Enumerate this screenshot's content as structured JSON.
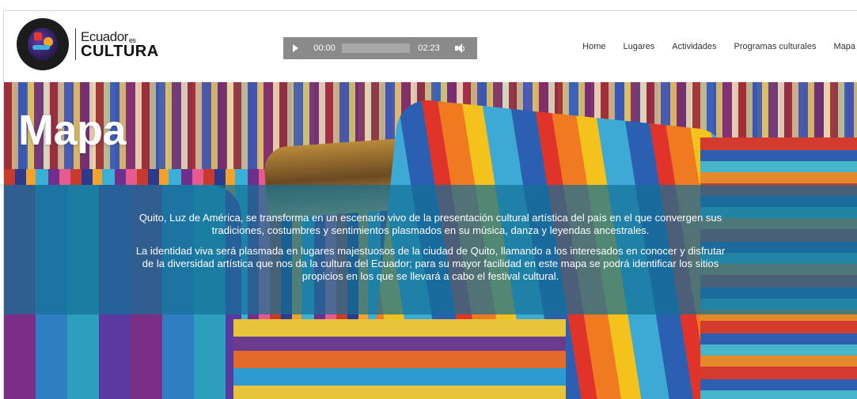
{
  "logo": {
    "top_text": "Ecuador",
    "sub_text": "es",
    "bottom_text": "CULTURA"
  },
  "player": {
    "current_time": "00:00",
    "duration": "02:23",
    "progress": 0
  },
  "nav": {
    "items": [
      "Home",
      "Lugares",
      "Actividades",
      "Programas culturales",
      "Mapa"
    ]
  },
  "hero": {
    "title": "Mapa",
    "paragraph_1": "Quito, Luz de América, se transforma en un escenario vivo de la presentación cultural artística del país en el que convergen sus tradiciones, costumbres y sentimientos plasmados en su música, danza y leyendas ancestrales.",
    "paragraph_2": "La identidad viva será plasmada en lugares majestuosos de la ciudad de Quito, llamando a los interesados en conocer y disfrutar de la diversidad artística que nos da la cultura del Ecuador; para su mayor facilidad en este mapa se podrá identificar los sitios propicios en los que se llevará a cabo el festival cultural."
  },
  "colors": {
    "overlay": "#1470a0",
    "player_bg": "#8a8a8a",
    "nav_text": "#333333"
  },
  "icons": {
    "play": "play-icon",
    "volume": "volume-icon",
    "logo": "logo-badge-icon"
  }
}
